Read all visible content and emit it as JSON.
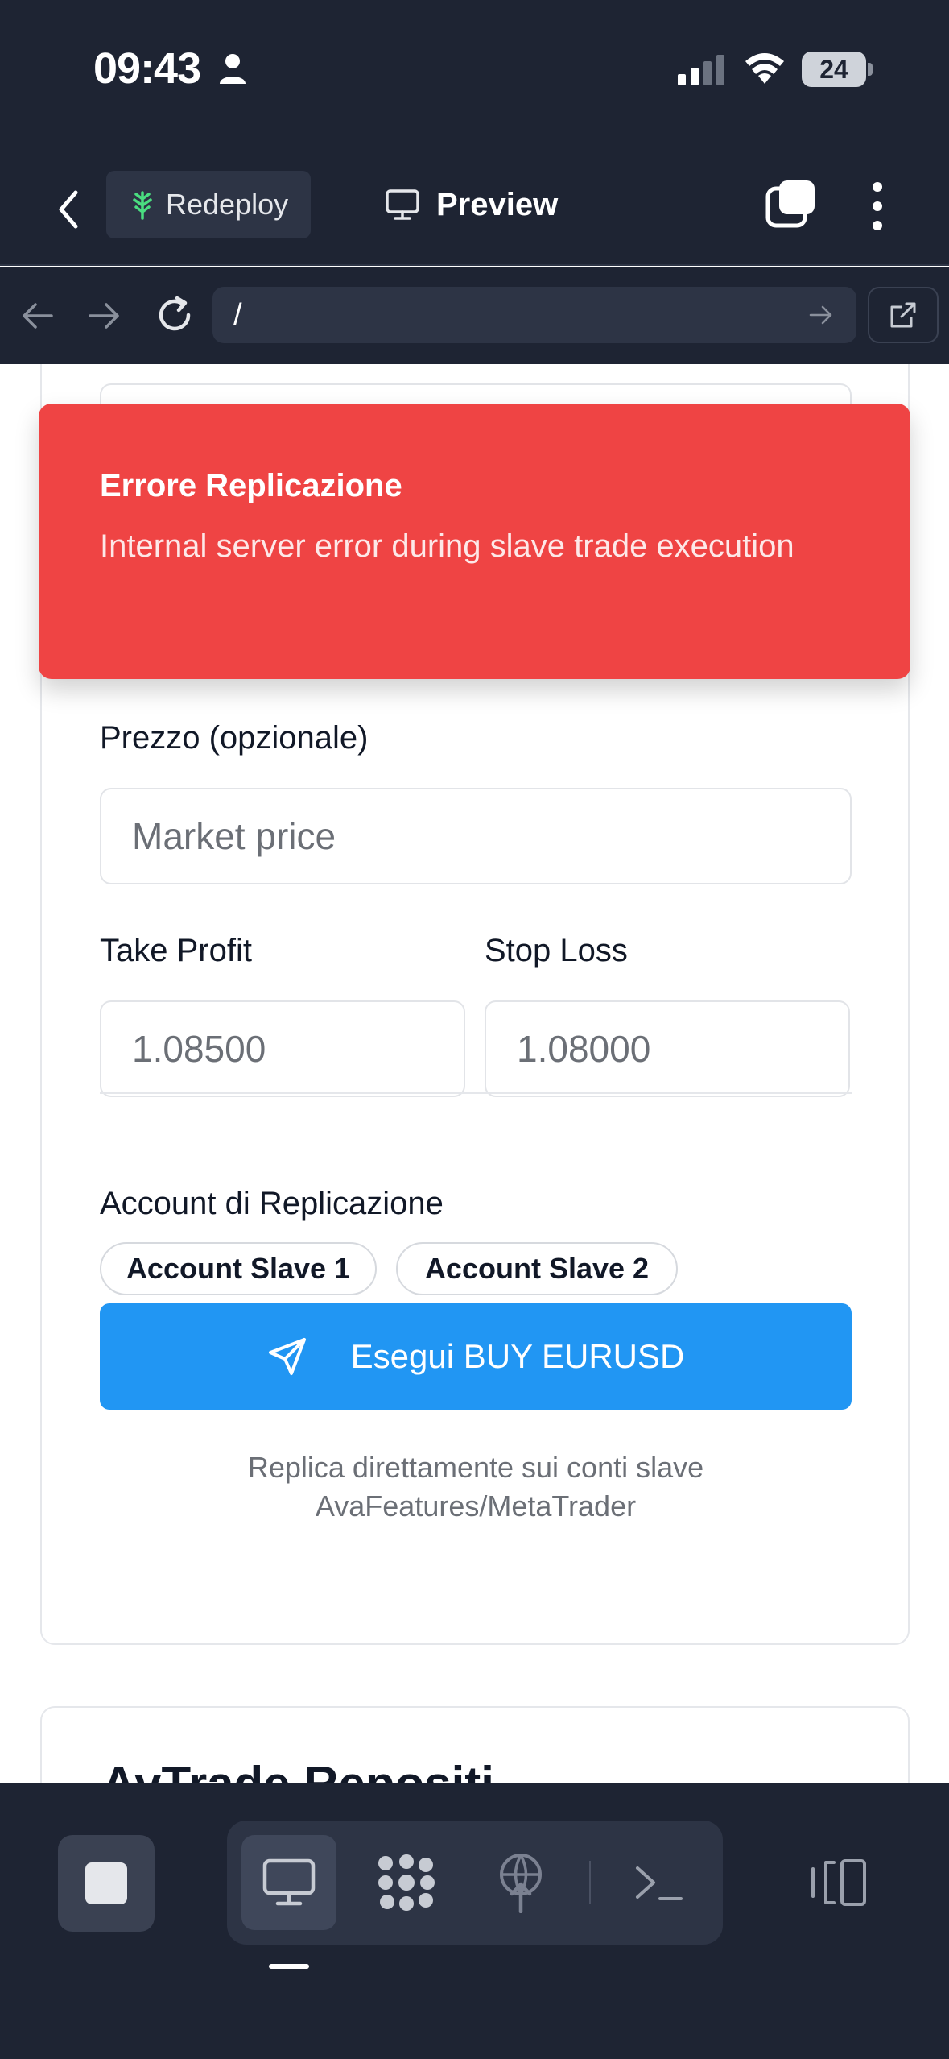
{
  "status_bar": {
    "time": "09:43",
    "battery": "24"
  },
  "header": {
    "redeploy_label": "Redeploy",
    "preview_label": "Preview"
  },
  "url_bar": {
    "url": "/"
  },
  "form": {
    "price_label": "Prezzo (opzionale)",
    "price_placeholder": "Market price",
    "take_profit_label": "Take Profit",
    "take_profit_placeholder": "1.08500",
    "stop_loss_label": "Stop Loss",
    "stop_loss_placeholder": "1.08000",
    "replication_label": "Account di Replicazione",
    "accounts": [
      "Account Slave 1",
      "Account Slave 2"
    ],
    "execute_label": "Esegui BUY EURUSD",
    "note": "Replica direttamente sui conti slave AvaFeatures/MetaTrader"
  },
  "next_card": {
    "title": "AvTrade Repositi"
  },
  "toast": {
    "title": "Errore Replicazione",
    "message": "Internal server error during slave trade execution"
  },
  "colors": {
    "toast_bg": "#ef4444",
    "primary_button": "#2196f3",
    "chrome_bg": "#1e2433"
  },
  "icons": {
    "status": [
      "person-icon",
      "signal-icon",
      "wifi-icon"
    ],
    "header": [
      "chevron-left-icon",
      "tree-icon",
      "monitor-icon",
      "tabs-icon",
      "more-vertical-icon"
    ],
    "url": [
      "arrow-left-icon",
      "arrow-right-icon",
      "reload-icon",
      "go-arrow-icon",
      "external-link-icon"
    ],
    "bottom": [
      "stop-icon",
      "monitor-icon",
      "grid-icon",
      "deploy-icon",
      "terminal-icon",
      "layout-icon"
    ]
  }
}
